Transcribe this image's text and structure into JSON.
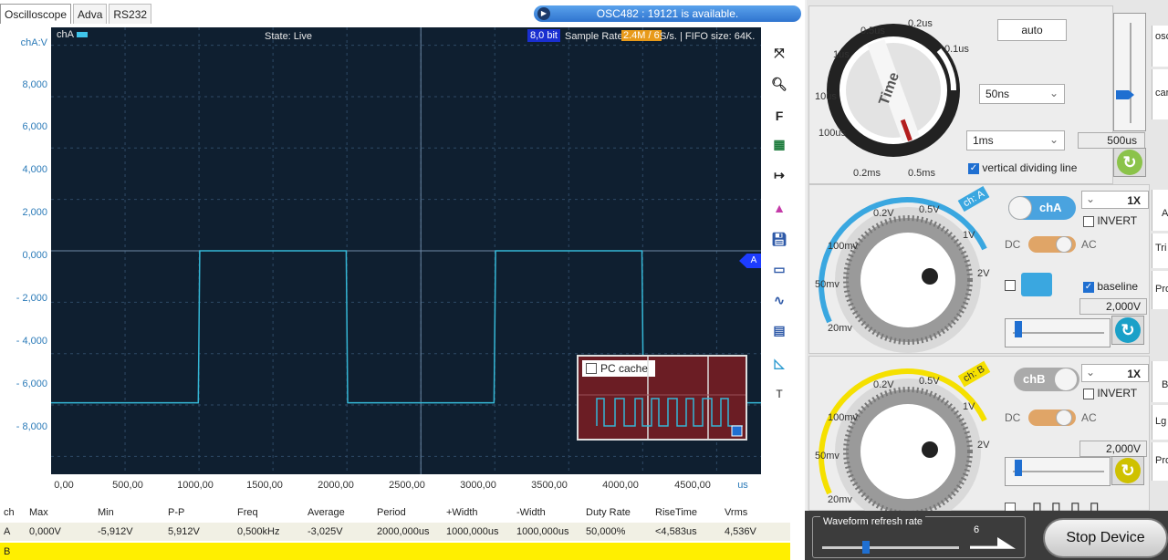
{
  "tabs": [
    "Oscilloscope",
    "Adva",
    "RS232"
  ],
  "status": {
    "text": "OSC482 : 19121 is available."
  },
  "y_axis": {
    "unit": "chA:V",
    "ticks": [
      "8,000",
      "6,000",
      "4,000",
      "2,000",
      "0,000",
      "- 2,000",
      "- 4,000",
      "- 6,000",
      "- 8,000"
    ]
  },
  "scope": {
    "channel": "chA",
    "state": "State: Live",
    "bits": "8,0 bit",
    "sample_rate_label": "Sample Rate:",
    "sample_rate_value": "2.4M / 6",
    "sample_rate_suffix": "S/s. | FIFO size: 64K.",
    "marker": "A"
  },
  "x_axis": {
    "ticks": [
      "0,00",
      "500,00",
      "1000,00",
      "1500,00",
      "2000,00",
      "2500,00",
      "3000,00",
      "3500,00",
      "4000,00",
      "4500,00"
    ],
    "unit": "us"
  },
  "chart_data": {
    "type": "line",
    "xlim": [
      0,
      4800
    ],
    "ylim": [
      -10,
      10
    ],
    "series": [
      {
        "x": [
          0,
          995,
          1005,
          1995,
          2005,
          2995,
          3005,
          3995,
          4005,
          4800
        ],
        "y": [
          -5.912,
          -5.912,
          0,
          0,
          -5.912,
          -5.912,
          0,
          0,
          -5.912,
          -5.912
        ]
      }
    ],
    "grid": true,
    "color": "#35b7d6"
  },
  "toolbar": {
    "f_label": "F",
    "t_label": "T"
  },
  "pc_cache": {
    "label": "PC cache"
  },
  "measurements": {
    "headers": [
      "ch",
      "Max",
      "Min",
      "P-P",
      "Freq",
      "Average",
      "Period",
      "+Width",
      "-Width",
      "Duty Rate",
      "RiseTime",
      "Vrms"
    ],
    "row_a": [
      "A",
      "0,000V",
      "-5,912V",
      "5,912V",
      "0,500kHz",
      "-3,025V",
      "2000,000us",
      "1000,000us",
      "1000,000us",
      "50,000%",
      "<4,583us",
      "4,536V"
    ],
    "row_b": [
      "B"
    ]
  },
  "timebase": {
    "knob_label": "Time",
    "dial_labels": [
      "0.5us",
      "0.2us",
      "0.1us",
      "1us",
      "10us",
      "100us",
      "0.2ms",
      "0.5ms"
    ],
    "auto_label": "auto",
    "select1": "50ns",
    "select2": "1ms",
    "value": "500us",
    "vertical_dividing_line": "vertical dividing line"
  },
  "channel_a": {
    "tag": "ch: A",
    "toggle": "chA",
    "probe": "1X",
    "invert": "INVERT",
    "dc": "DC",
    "ac": "AC",
    "baseline": "baseline",
    "volts": "2,000V",
    "dial_labels": [
      "0.2V",
      "0.5V",
      "100mv",
      "1V",
      "50mv",
      "2V",
      "20mv"
    ]
  },
  "channel_b": {
    "tag": "ch: B",
    "toggle": "chB",
    "probe": "1X",
    "invert": "INVERT",
    "dc": "DC",
    "ac": "AC",
    "volts": "2,000V",
    "dial_labels": [
      "0.2V",
      "0.5V",
      "100mv",
      "1V",
      "50mv",
      "2V",
      "20mv"
    ]
  },
  "side_buttons": [
    "osc",
    "car",
    "A",
    "Tri",
    "Pro",
    "B",
    "Lg",
    "Pro"
  ],
  "refresh": {
    "label": "Waveform refresh rate",
    "value": "6"
  },
  "stop_button": "Stop Device",
  "colors": {
    "accent_a": "#3aa7e0",
    "accent_b": "#f5e000",
    "trace": "#35b7d6",
    "scope_bg": "#0f1f30"
  }
}
